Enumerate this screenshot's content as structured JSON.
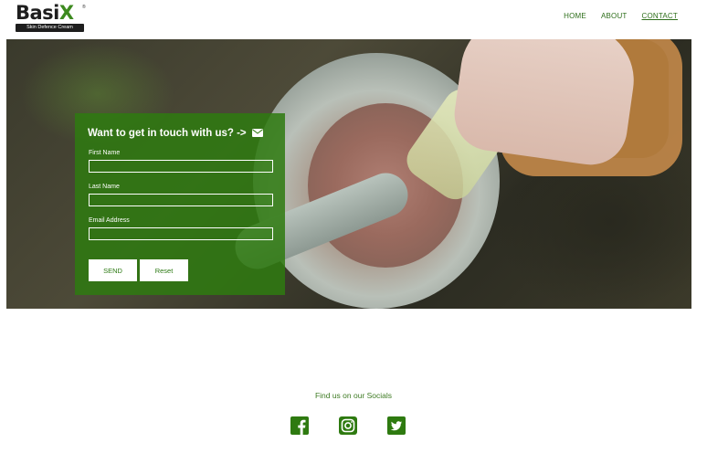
{
  "brand": {
    "logo_text_a": "Basi",
    "logo_text_b": "X",
    "logo_reg": "®",
    "tagline": "Skin Defence Cream",
    "accent_color": "#2e7a10"
  },
  "nav": {
    "items": [
      {
        "label": "HOME"
      },
      {
        "label": "ABOUT"
      },
      {
        "label": "CONTACT",
        "active": true
      }
    ]
  },
  "contact_form": {
    "title": "Want to get in touch with us? ->",
    "title_icon": "envelope-icon",
    "fields": [
      {
        "label": "First Name",
        "value": ""
      },
      {
        "label": "Last Name",
        "value": ""
      },
      {
        "label": "Email Address",
        "value": ""
      }
    ],
    "send_label": "SEND",
    "reset_label": "Reset"
  },
  "socials": {
    "title": "Find us on our Socials",
    "icons": [
      "facebook-icon",
      "instagram-icon",
      "twitter-icon"
    ],
    "icon_color": "#2e7a10"
  }
}
